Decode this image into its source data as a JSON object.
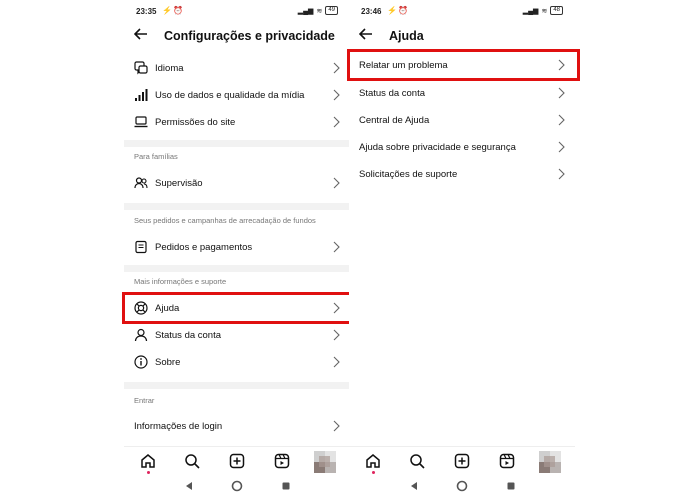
{
  "left": {
    "status": {
      "time": "23:35",
      "battery": "49"
    },
    "title": "Configurações e privacidade",
    "items_top": [
      {
        "label": "Idioma",
        "icon": "language-icon"
      },
      {
        "label": "Uso de dados e qualidade da mídia",
        "icon": "signal-bars-icon"
      },
      {
        "label": "Permissões do site",
        "icon": "laptop-icon"
      }
    ],
    "section_families": "Para famílias",
    "supervision": {
      "label": "Supervisão",
      "icon": "people-icon"
    },
    "section_orders": "Seus pedidos e campanhas de arrecadação de fundos",
    "orders": {
      "label": "Pedidos e pagamentos",
      "icon": "receipt-icon"
    },
    "section_support": "Mais informações e suporte",
    "help": {
      "label": "Ajuda",
      "icon": "lifebuoy-icon"
    },
    "account_status": {
      "label": "Status da conta",
      "icon": "person-icon"
    },
    "about": {
      "label": "Sobre",
      "icon": "info-icon"
    },
    "section_login": "Entrar",
    "login_info": "Informações de login"
  },
  "right": {
    "status": {
      "time": "23:46",
      "battery": "48"
    },
    "title": "Ajuda",
    "items": [
      "Relatar um problema",
      "Status da conta",
      "Central de Ajuda",
      "Ajuda sobre privacidade e segurança",
      "Solicitações de suporte"
    ]
  },
  "colors": {
    "highlight": "#e01010",
    "accent_dot": "#e0245e"
  }
}
